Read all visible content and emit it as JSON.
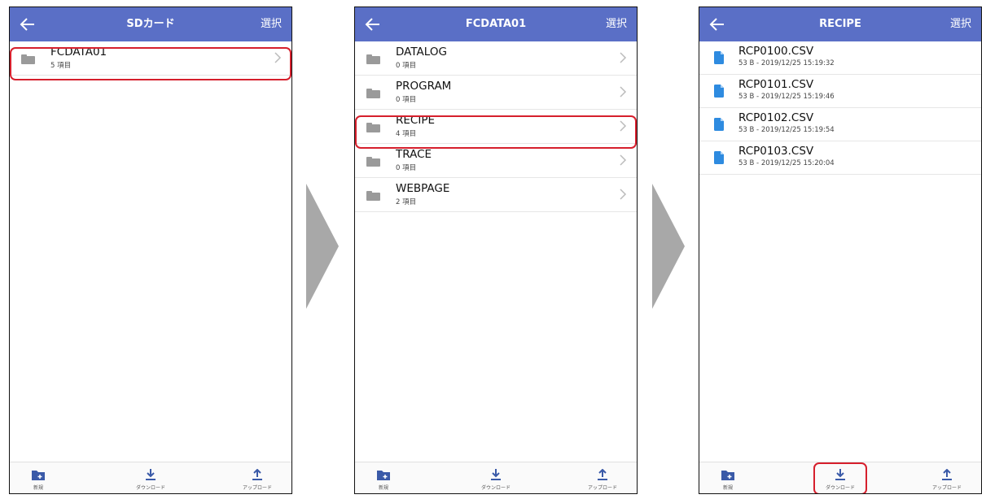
{
  "screens": [
    {
      "title": "SDカード",
      "select_label": "選択",
      "folders": [
        {
          "name": "FCDATA01",
          "sub": "5 項目"
        }
      ]
    },
    {
      "title": "FCDATA01",
      "select_label": "選択",
      "folders": [
        {
          "name": "DATALOG",
          "sub": "0 項目"
        },
        {
          "name": "PROGRAM",
          "sub": "0 項目"
        },
        {
          "name": "RECIPE",
          "sub": "4 項目"
        },
        {
          "name": "TRACE",
          "sub": "0 項目"
        },
        {
          "name": "WEBPAGE",
          "sub": "2 項目"
        }
      ]
    },
    {
      "title": "RECIPE",
      "select_label": "選択",
      "files": [
        {
          "name": "RCP0100.CSV",
          "sub": "53 B - 2019/12/25 15:19:32"
        },
        {
          "name": "RCP0101.CSV",
          "sub": "53 B - 2019/12/25 15:19:46"
        },
        {
          "name": "RCP0102.CSV",
          "sub": "53 B - 2019/12/25 15:19:54"
        },
        {
          "name": "RCP0103.CSV",
          "sub": "53 B - 2019/12/25 15:20:04"
        }
      ]
    }
  ],
  "toolbar": {
    "new_label": "新規",
    "download_label": "ダウンロード",
    "upload_label": "アップロード"
  },
  "icons": {
    "back": "arrow-left-icon",
    "folder": "folder-icon",
    "chevron": "chevron-right-icon",
    "file": "file-icon",
    "new_folder": "new-folder-icon",
    "download": "download-icon",
    "upload": "upload-icon",
    "step": "step-arrow-icon"
  },
  "colors": {
    "header": "#5a6fc6",
    "highlight": "#d61f2c",
    "folder": "#9a9a9a",
    "file": "#2e8be0",
    "toolbar_icon": "#3a5aa8",
    "step_arrow": "#a8a8a8"
  }
}
